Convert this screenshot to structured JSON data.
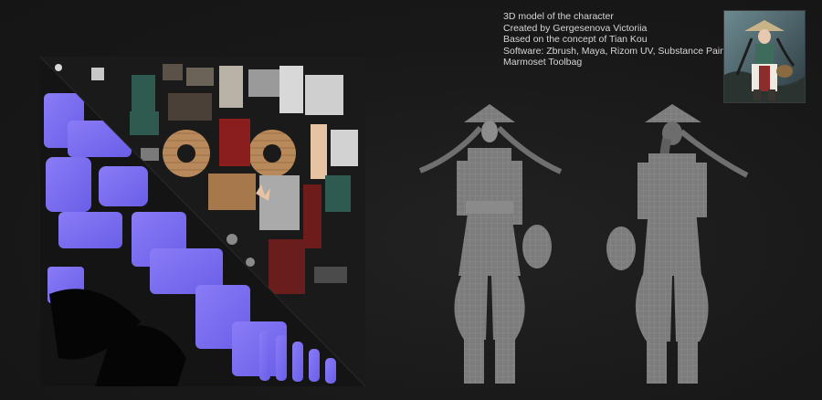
{
  "credits": {
    "lines": [
      "3D model of the character",
      "Created by Gergesenova Victoriia",
      "Based on the concept of Tian Kou",
      "Software: Zbrush, Maya, Rizom UV, Substance Painter,",
      "Marmoset Toolbag"
    ]
  },
  "colors": {
    "background": "#191919",
    "text": "#d6d6d6",
    "normal_map": "#7a6cf0",
    "wireframe_mesh": "#8a8a8a",
    "wood_texture": "#b8895a",
    "cloth_green": "#2f5a50"
  },
  "images": {
    "texture_atlas": "uv-texture-atlas",
    "model_front": "wireframe-front-view",
    "model_back": "wireframe-back-view",
    "concept_thumbnail": "concept-art-thumbnail"
  }
}
